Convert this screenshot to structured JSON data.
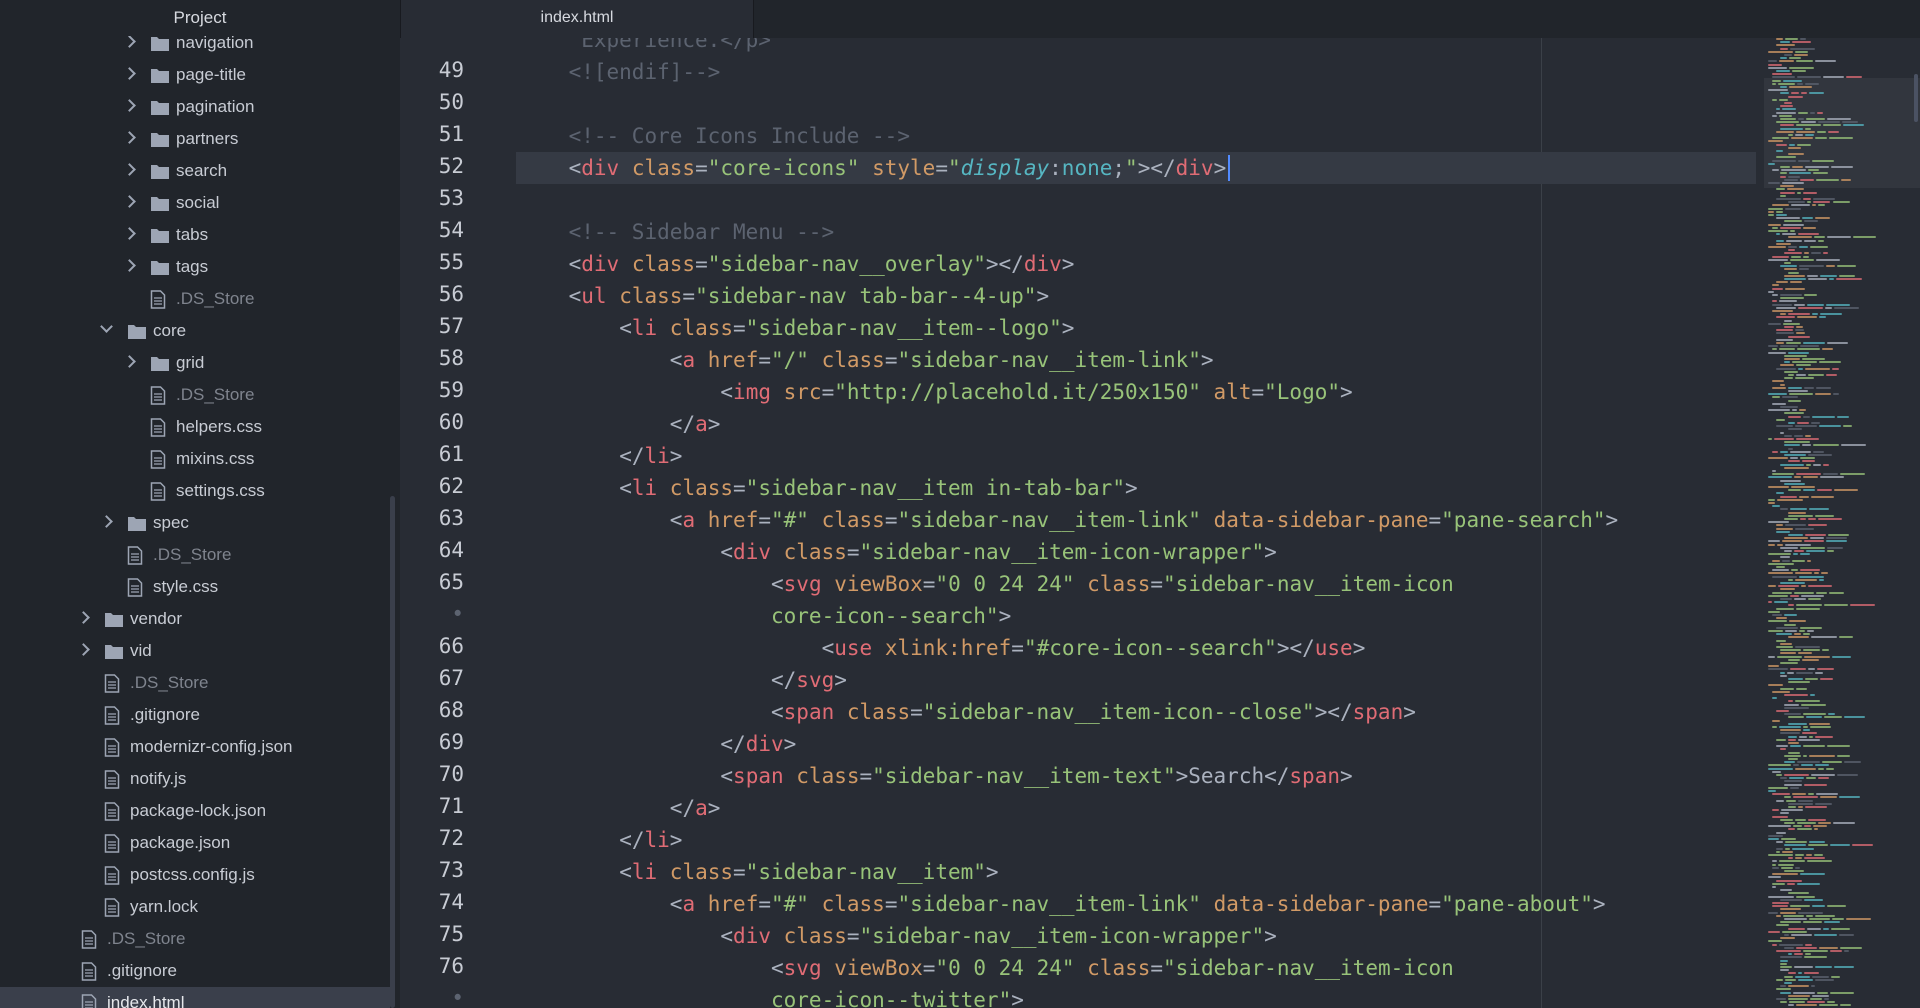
{
  "sidebar": {
    "title": "Project",
    "items": [
      {
        "label": "navigation",
        "kind": "folder",
        "state": "collapsed",
        "level": 2,
        "partial": true
      },
      {
        "label": "page-title",
        "kind": "folder",
        "state": "collapsed",
        "level": 2
      },
      {
        "label": "pagination",
        "kind": "folder",
        "state": "collapsed",
        "level": 2
      },
      {
        "label": "partners",
        "kind": "folder",
        "state": "collapsed",
        "level": 2
      },
      {
        "label": "search",
        "kind": "folder",
        "state": "collapsed",
        "level": 2
      },
      {
        "label": "social",
        "kind": "folder",
        "state": "collapsed",
        "level": 2
      },
      {
        "label": "tabs",
        "kind": "folder",
        "state": "collapsed",
        "level": 2
      },
      {
        "label": "tags",
        "kind": "folder",
        "state": "collapsed",
        "level": 2
      },
      {
        "label": ".DS_Store",
        "kind": "file",
        "dim": true,
        "level": 2
      },
      {
        "label": "core",
        "kind": "folder",
        "state": "expanded",
        "level": 1
      },
      {
        "label": "grid",
        "kind": "folder",
        "state": "collapsed",
        "level": 2
      },
      {
        "label": ".DS_Store",
        "kind": "file",
        "dim": true,
        "level": 2
      },
      {
        "label": "helpers.css",
        "kind": "file",
        "level": 2
      },
      {
        "label": "mixins.css",
        "kind": "file",
        "level": 2
      },
      {
        "label": "settings.css",
        "kind": "file",
        "level": 2
      },
      {
        "label": "spec",
        "kind": "folder",
        "state": "collapsed",
        "level": 1
      },
      {
        "label": ".DS_Store",
        "kind": "file",
        "dim": true,
        "level": 1
      },
      {
        "label": "style.css",
        "kind": "file",
        "level": 1
      },
      {
        "label": "vendor",
        "kind": "folder",
        "state": "collapsed",
        "level": 0
      },
      {
        "label": "vid",
        "kind": "folder",
        "state": "collapsed",
        "level": 0
      },
      {
        "label": ".DS_Store",
        "kind": "file",
        "dim": true,
        "level": 0
      },
      {
        "label": ".gitignore",
        "kind": "file",
        "level": 0
      },
      {
        "label": "modernizr-config.json",
        "kind": "file",
        "level": 0
      },
      {
        "label": "notify.js",
        "kind": "file",
        "level": 0
      },
      {
        "label": "package-lock.json",
        "kind": "file",
        "level": 0
      },
      {
        "label": "package.json",
        "kind": "file",
        "level": 0
      },
      {
        "label": "postcss.config.js",
        "kind": "file",
        "level": 0
      },
      {
        "label": "yarn.lock",
        "kind": "file",
        "level": 0
      },
      {
        "label": ".DS_Store",
        "kind": "file",
        "dim": true,
        "level": -1
      },
      {
        "label": ".gitignore",
        "kind": "file",
        "level": -1
      },
      {
        "label": "index.html",
        "kind": "file",
        "level": -1,
        "selected": true
      }
    ]
  },
  "tabs": [
    {
      "label": "index.html",
      "active": true
    }
  ],
  "editor": {
    "cursor_line": "52",
    "lines": [
      {
        "n": "",
        "indent": 5,
        "tokens": [
          [
            "com",
            "Experience.</p>"
          ]
        ]
      },
      {
        "n": "49",
        "indent": 4,
        "tokens": [
          [
            "com",
            "<![endif]-->"
          ]
        ]
      },
      {
        "n": "50",
        "indent": 0,
        "tokens": []
      },
      {
        "n": "51",
        "indent": 4,
        "tokens": [
          [
            "com",
            "<!-- Core Icons Include -->"
          ]
        ]
      },
      {
        "n": "52",
        "indent": 4,
        "tokens": [
          [
            "punct",
            "<"
          ],
          [
            "tag",
            "div"
          ],
          [
            "punct",
            " "
          ],
          [
            "attr",
            "class"
          ],
          [
            "punct",
            "="
          ],
          [
            "str",
            "\"core-icons\""
          ],
          [
            "punct",
            " "
          ],
          [
            "attr",
            "style"
          ],
          [
            "punct",
            "="
          ],
          [
            "str",
            "\""
          ],
          [
            "prop",
            "display"
          ],
          [
            "punct",
            ":"
          ],
          [
            "val",
            "none"
          ],
          [
            "punct",
            ";"
          ],
          [
            "str",
            "\""
          ],
          [
            "punct",
            "></"
          ],
          [
            "tag",
            "div"
          ],
          [
            "punct",
            ">"
          ]
        ]
      },
      {
        "n": "53",
        "indent": 0,
        "tokens": []
      },
      {
        "n": "54",
        "indent": 4,
        "tokens": [
          [
            "com",
            "<!-- Sidebar Menu -->"
          ]
        ]
      },
      {
        "n": "55",
        "indent": 4,
        "tokens": [
          [
            "punct",
            "<"
          ],
          [
            "tag",
            "div"
          ],
          [
            "punct",
            " "
          ],
          [
            "attr",
            "class"
          ],
          [
            "punct",
            "="
          ],
          [
            "str",
            "\"sidebar-nav__overlay\""
          ],
          [
            "punct",
            "></"
          ],
          [
            "tag",
            "div"
          ],
          [
            "punct",
            ">"
          ]
        ]
      },
      {
        "n": "56",
        "indent": 4,
        "tokens": [
          [
            "punct",
            "<"
          ],
          [
            "tag",
            "ul"
          ],
          [
            "punct",
            " "
          ],
          [
            "attr",
            "class"
          ],
          [
            "punct",
            "="
          ],
          [
            "str",
            "\"sidebar-nav tab-bar--4-up\""
          ],
          [
            "punct",
            ">"
          ]
        ]
      },
      {
        "n": "57",
        "indent": 8,
        "tokens": [
          [
            "punct",
            "<"
          ],
          [
            "tag",
            "li"
          ],
          [
            "punct",
            " "
          ],
          [
            "attr",
            "class"
          ],
          [
            "punct",
            "="
          ],
          [
            "str",
            "\"sidebar-nav__item--logo\""
          ],
          [
            "punct",
            ">"
          ]
        ]
      },
      {
        "n": "58",
        "indent": 12,
        "tokens": [
          [
            "punct",
            "<"
          ],
          [
            "tag",
            "a"
          ],
          [
            "punct",
            " "
          ],
          [
            "attr",
            "href"
          ],
          [
            "punct",
            "="
          ],
          [
            "str",
            "\"/\""
          ],
          [
            "punct",
            " "
          ],
          [
            "attr",
            "class"
          ],
          [
            "punct",
            "="
          ],
          [
            "str",
            "\"sidebar-nav__item-link\""
          ],
          [
            "punct",
            ">"
          ]
        ]
      },
      {
        "n": "59",
        "indent": 16,
        "tokens": [
          [
            "punct",
            "<"
          ],
          [
            "tag",
            "img"
          ],
          [
            "punct",
            " "
          ],
          [
            "attr",
            "src"
          ],
          [
            "punct",
            "="
          ],
          [
            "str",
            "\"http://placehold.it/250x150\""
          ],
          [
            "punct",
            " "
          ],
          [
            "attr",
            "alt"
          ],
          [
            "punct",
            "="
          ],
          [
            "str",
            "\"Logo\""
          ],
          [
            "punct",
            ">"
          ]
        ]
      },
      {
        "n": "60",
        "indent": 12,
        "tokens": [
          [
            "punct",
            "</"
          ],
          [
            "tag",
            "a"
          ],
          [
            "punct",
            ">"
          ]
        ]
      },
      {
        "n": "61",
        "indent": 8,
        "tokens": [
          [
            "punct",
            "</"
          ],
          [
            "tag",
            "li"
          ],
          [
            "punct",
            ">"
          ]
        ]
      },
      {
        "n": "62",
        "indent": 8,
        "tokens": [
          [
            "punct",
            "<"
          ],
          [
            "tag",
            "li"
          ],
          [
            "punct",
            " "
          ],
          [
            "attr",
            "class"
          ],
          [
            "punct",
            "="
          ],
          [
            "str",
            "\"sidebar-nav__item in-tab-bar\""
          ],
          [
            "punct",
            ">"
          ]
        ]
      },
      {
        "n": "63",
        "indent": 12,
        "tokens": [
          [
            "punct",
            "<"
          ],
          [
            "tag",
            "a"
          ],
          [
            "punct",
            " "
          ],
          [
            "attr",
            "href"
          ],
          [
            "punct",
            "="
          ],
          [
            "str",
            "\"#\""
          ],
          [
            "punct",
            " "
          ],
          [
            "attr",
            "class"
          ],
          [
            "punct",
            "="
          ],
          [
            "str",
            "\"sidebar-nav__item-link\""
          ],
          [
            "punct",
            " "
          ],
          [
            "attr",
            "data-sidebar-pane"
          ],
          [
            "punct",
            "="
          ],
          [
            "str",
            "\"pane-search\""
          ],
          [
            "punct",
            ">"
          ]
        ]
      },
      {
        "n": "64",
        "indent": 16,
        "tokens": [
          [
            "punct",
            "<"
          ],
          [
            "tag",
            "div"
          ],
          [
            "punct",
            " "
          ],
          [
            "attr",
            "class"
          ],
          [
            "punct",
            "="
          ],
          [
            "str",
            "\"sidebar-nav__item-icon-wrapper\""
          ],
          [
            "punct",
            ">"
          ]
        ]
      },
      {
        "n": "65",
        "indent": 20,
        "tokens": [
          [
            "punct",
            "<"
          ],
          [
            "tag",
            "svg"
          ],
          [
            "punct",
            " "
          ],
          [
            "attr",
            "viewBox"
          ],
          [
            "punct",
            "="
          ],
          [
            "str",
            "\"0 0 24 24\""
          ],
          [
            "punct",
            " "
          ],
          [
            "attr",
            "class"
          ],
          [
            "punct",
            "="
          ],
          [
            "str",
            "\"sidebar-nav__item-icon"
          ]
        ]
      },
      {
        "n": "•",
        "soft": true,
        "indent": 20,
        "tokens": [
          [
            "str",
            "core-icon--search\""
          ],
          [
            "punct",
            ">"
          ]
        ]
      },
      {
        "n": "66",
        "indent": 24,
        "tokens": [
          [
            "punct",
            "<"
          ],
          [
            "tag",
            "use"
          ],
          [
            "punct",
            " "
          ],
          [
            "attr",
            "xlink:href"
          ],
          [
            "punct",
            "="
          ],
          [
            "str",
            "\"#core-icon--search\""
          ],
          [
            "punct",
            "></"
          ],
          [
            "tag",
            "use"
          ],
          [
            "punct",
            ">"
          ]
        ]
      },
      {
        "n": "67",
        "indent": 20,
        "tokens": [
          [
            "punct",
            "</"
          ],
          [
            "tag",
            "svg"
          ],
          [
            "punct",
            ">"
          ]
        ]
      },
      {
        "n": "68",
        "indent": 20,
        "tokens": [
          [
            "punct",
            "<"
          ],
          [
            "tag",
            "span"
          ],
          [
            "punct",
            " "
          ],
          [
            "attr",
            "class"
          ],
          [
            "punct",
            "="
          ],
          [
            "str",
            "\"sidebar-nav__item-icon--close\""
          ],
          [
            "punct",
            "></"
          ],
          [
            "tag",
            "span"
          ],
          [
            "punct",
            ">"
          ]
        ]
      },
      {
        "n": "69",
        "indent": 16,
        "tokens": [
          [
            "punct",
            "</"
          ],
          [
            "tag",
            "div"
          ],
          [
            "punct",
            ">"
          ]
        ]
      },
      {
        "n": "70",
        "indent": 16,
        "tokens": [
          [
            "punct",
            "<"
          ],
          [
            "tag",
            "span"
          ],
          [
            "punct",
            " "
          ],
          [
            "attr",
            "class"
          ],
          [
            "punct",
            "="
          ],
          [
            "str",
            "\"sidebar-nav__item-text\""
          ],
          [
            "punct",
            ">"
          ],
          [
            "text",
            "Search"
          ],
          [
            "punct",
            "</"
          ],
          [
            "tag",
            "span"
          ],
          [
            "punct",
            ">"
          ]
        ]
      },
      {
        "n": "71",
        "indent": 12,
        "tokens": [
          [
            "punct",
            "</"
          ],
          [
            "tag",
            "a"
          ],
          [
            "punct",
            ">"
          ]
        ]
      },
      {
        "n": "72",
        "indent": 8,
        "tokens": [
          [
            "punct",
            "</"
          ],
          [
            "tag",
            "li"
          ],
          [
            "punct",
            ">"
          ]
        ]
      },
      {
        "n": "73",
        "indent": 8,
        "tokens": [
          [
            "punct",
            "<"
          ],
          [
            "tag",
            "li"
          ],
          [
            "punct",
            " "
          ],
          [
            "attr",
            "class"
          ],
          [
            "punct",
            "="
          ],
          [
            "str",
            "\"sidebar-nav__item\""
          ],
          [
            "punct",
            ">"
          ]
        ]
      },
      {
        "n": "74",
        "indent": 12,
        "tokens": [
          [
            "punct",
            "<"
          ],
          [
            "tag",
            "a"
          ],
          [
            "punct",
            " "
          ],
          [
            "attr",
            "href"
          ],
          [
            "punct",
            "="
          ],
          [
            "str",
            "\"#\""
          ],
          [
            "punct",
            " "
          ],
          [
            "attr",
            "class"
          ],
          [
            "punct",
            "="
          ],
          [
            "str",
            "\"sidebar-nav__item-link\""
          ],
          [
            "punct",
            " "
          ],
          [
            "attr",
            "data-sidebar-pane"
          ],
          [
            "punct",
            "="
          ],
          [
            "str",
            "\"pane-about\""
          ],
          [
            "punct",
            ">"
          ]
        ]
      },
      {
        "n": "75",
        "indent": 16,
        "tokens": [
          [
            "punct",
            "<"
          ],
          [
            "tag",
            "div"
          ],
          [
            "punct",
            " "
          ],
          [
            "attr",
            "class"
          ],
          [
            "punct",
            "="
          ],
          [
            "str",
            "\"sidebar-nav__item-icon-wrapper\""
          ],
          [
            "punct",
            ">"
          ]
        ]
      },
      {
        "n": "76",
        "indent": 20,
        "tokens": [
          [
            "punct",
            "<"
          ],
          [
            "tag",
            "svg"
          ],
          [
            "punct",
            " "
          ],
          [
            "attr",
            "viewBox"
          ],
          [
            "punct",
            "="
          ],
          [
            "str",
            "\"0 0 24 24\""
          ],
          [
            "punct",
            " "
          ],
          [
            "attr",
            "class"
          ],
          [
            "punct",
            "="
          ],
          [
            "str",
            "\"sidebar-nav__item-icon"
          ]
        ]
      },
      {
        "n": "•",
        "soft": true,
        "indent": 20,
        "tokens": [
          [
            "str",
            "core-icon--twitter\""
          ],
          [
            "punct",
            ">"
          ]
        ]
      }
    ]
  },
  "colors": {
    "background": "#282c34",
    "sidebar": "#21252b",
    "selection": "#3a3f4b",
    "tag": "#e06c75",
    "attribute": "#d19a66",
    "string": "#98c379",
    "comment": "#5c6370",
    "cursor": "#528bff"
  }
}
